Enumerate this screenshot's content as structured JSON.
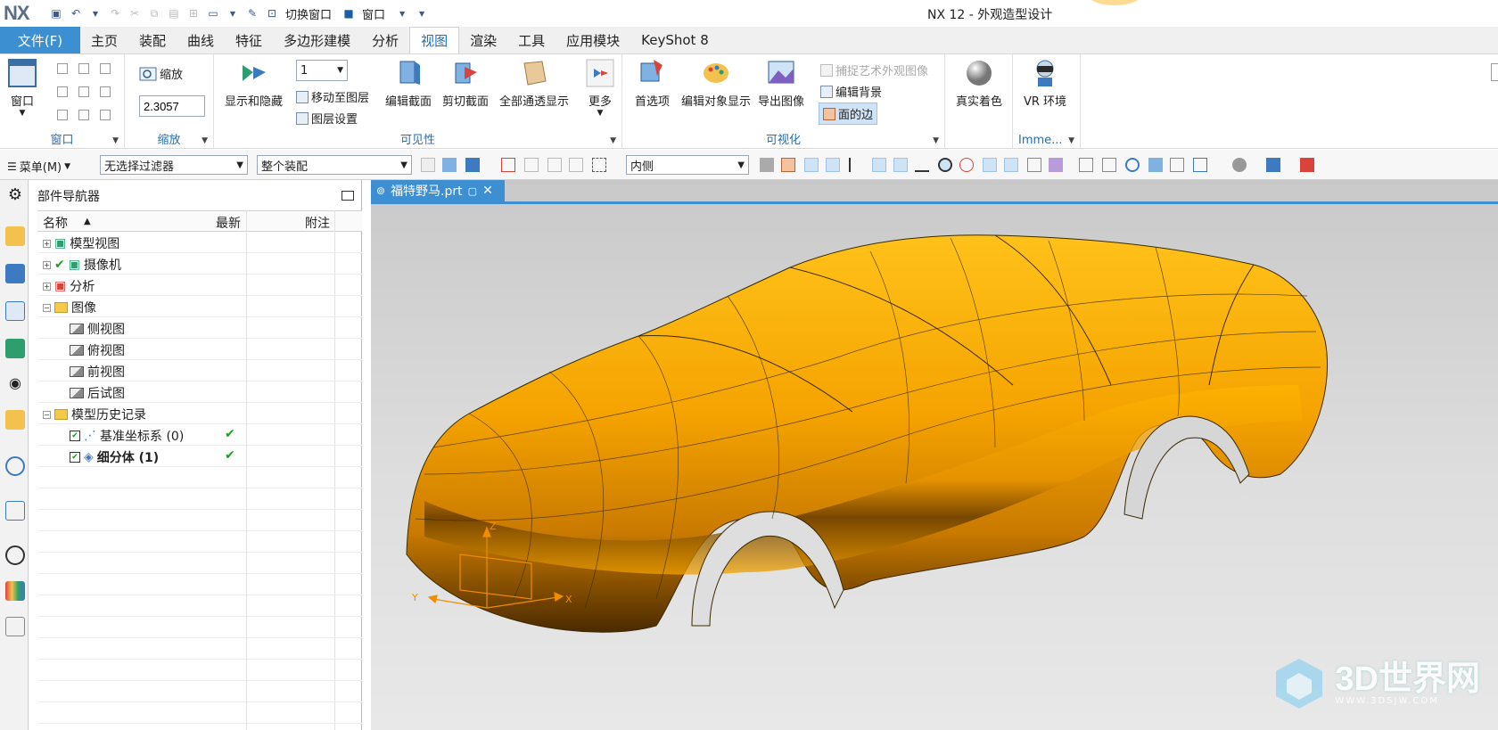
{
  "app": {
    "logo": "NX",
    "title": "NX 12 - 外观造型设计",
    "quick_access": {
      "switch_window": "切换窗口",
      "window": "窗口"
    }
  },
  "menu": {
    "file": "文件(F)",
    "tabs": [
      "主页",
      "装配",
      "曲线",
      "特征",
      "多边形建模",
      "分析",
      "视图",
      "渲染",
      "工具",
      "应用模块",
      "KeyShot 8"
    ],
    "active_tab": "视图"
  },
  "ribbon": {
    "window_group": {
      "label": "窗口",
      "button": "窗口"
    },
    "zoom_group": {
      "label": "缩放",
      "zoom_button": "缩放",
      "zoom_value": "2.3057"
    },
    "visibility_group": {
      "label": "可见性",
      "show_hide": "显示和隐藏",
      "layer_value": "1",
      "move_to_layer": "移动至图层",
      "layer_settings": "图层设置",
      "edit_section": "编辑截面",
      "clip_section": "剪切截面",
      "full_transparent": "全部通透显示",
      "more": "更多"
    },
    "visualization_group": {
      "label": "可视化",
      "preferences": "首选项",
      "edit_object_display": "编辑对象显示",
      "export_image": "导出图像",
      "capture_art": "捕捉艺术外观图像",
      "edit_background": "编辑背景",
      "face_edges": "面的边"
    },
    "true_shading": "真实着色",
    "vr": {
      "button": "VR 环境",
      "group_label": "Imme..."
    }
  },
  "commandbar": {
    "menu": "菜单(M)",
    "filter": "无选择过滤器",
    "scope": "整个装配",
    "inside": "内侧"
  },
  "navigator": {
    "title": "部件导航器",
    "columns": [
      "名称",
      "最新",
      "附注"
    ],
    "rows": [
      {
        "name": "模型视图",
        "indent": 0
      },
      {
        "name": "摄像机",
        "indent": 0
      },
      {
        "name": "分析",
        "indent": 0
      },
      {
        "name": "图像",
        "indent": 0
      },
      {
        "name": "侧视图",
        "indent": 1
      },
      {
        "name": "俯视图",
        "indent": 1
      },
      {
        "name": "前视图",
        "indent": 1
      },
      {
        "name": "后试图",
        "indent": 1
      },
      {
        "name": "模型历史记录",
        "indent": 0
      },
      {
        "name": "基准坐标系 (0)",
        "indent": 1
      },
      {
        "name": "细分体 (1)",
        "indent": 1
      }
    ]
  },
  "viewport": {
    "tab": "福特野马.prt",
    "watermark": "3D世界网",
    "watermark_url": "WWW.3DSJW.COM",
    "axis_x": "X",
    "axis_y": "Y",
    "axis_z": "Z"
  },
  "colors": {
    "accent": "#3c8fd0",
    "car_body": "#f5a300",
    "check": "#1ea01e"
  }
}
